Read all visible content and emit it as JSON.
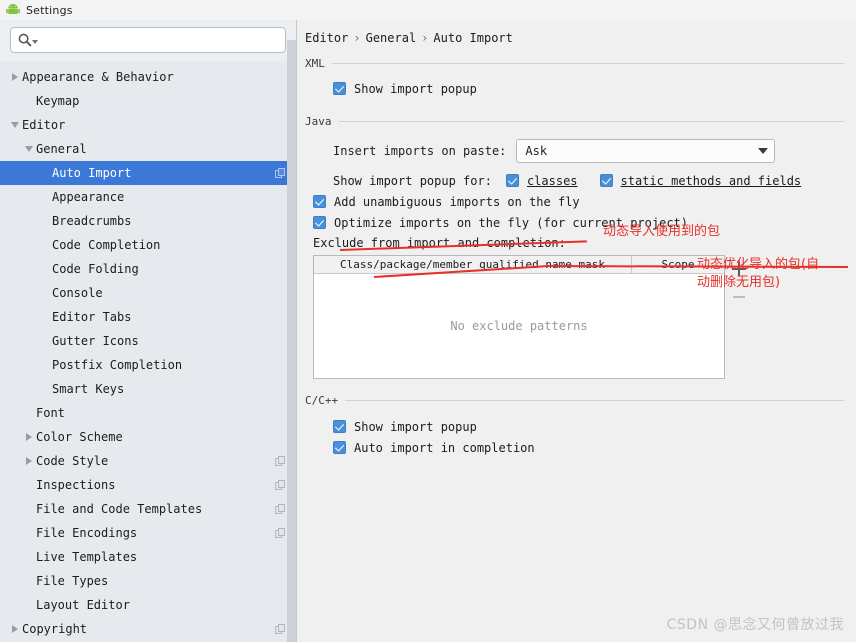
{
  "window": {
    "title": "Settings",
    "app_icon": "android-icon"
  },
  "search": {
    "value": "",
    "placeholder": "",
    "icon": "search-icon",
    "dropdown_icon": "chevron-down-icon"
  },
  "sidebar": {
    "items": [
      {
        "label": "Appearance & Behavior",
        "level": 0,
        "twisty": "closed",
        "selected": false,
        "copy": false
      },
      {
        "label": "Keymap",
        "level": 1,
        "twisty": "none",
        "selected": false,
        "copy": false
      },
      {
        "label": "Editor",
        "level": 0,
        "twisty": "open",
        "selected": false,
        "copy": false
      },
      {
        "label": "General",
        "level": 1,
        "twisty": "open",
        "selected": false,
        "copy": false
      },
      {
        "label": "Auto Import",
        "level": 2,
        "twisty": "none",
        "selected": true,
        "copy": true
      },
      {
        "label": "Appearance",
        "level": 2,
        "twisty": "none",
        "selected": false,
        "copy": false
      },
      {
        "label": "Breadcrumbs",
        "level": 2,
        "twisty": "none",
        "selected": false,
        "copy": false
      },
      {
        "label": "Code Completion",
        "level": 2,
        "twisty": "none",
        "selected": false,
        "copy": false
      },
      {
        "label": "Code Folding",
        "level": 2,
        "twisty": "none",
        "selected": false,
        "copy": false
      },
      {
        "label": "Console",
        "level": 2,
        "twisty": "none",
        "selected": false,
        "copy": false
      },
      {
        "label": "Editor Tabs",
        "level": 2,
        "twisty": "none",
        "selected": false,
        "copy": false
      },
      {
        "label": "Gutter Icons",
        "level": 2,
        "twisty": "none",
        "selected": false,
        "copy": false
      },
      {
        "label": "Postfix Completion",
        "level": 2,
        "twisty": "none",
        "selected": false,
        "copy": false
      },
      {
        "label": "Smart Keys",
        "level": 2,
        "twisty": "none",
        "selected": false,
        "copy": false
      },
      {
        "label": "Font",
        "level": 1,
        "twisty": "none",
        "selected": false,
        "copy": false
      },
      {
        "label": "Color Scheme",
        "level": 1,
        "twisty": "closed",
        "selected": false,
        "copy": false
      },
      {
        "label": "Code Style",
        "level": 1,
        "twisty": "closed",
        "selected": false,
        "copy": true
      },
      {
        "label": "Inspections",
        "level": 1,
        "twisty": "none",
        "selected": false,
        "copy": true
      },
      {
        "label": "File and Code Templates",
        "level": 1,
        "twisty": "none",
        "selected": false,
        "copy": true
      },
      {
        "label": "File Encodings",
        "level": 1,
        "twisty": "none",
        "selected": false,
        "copy": true
      },
      {
        "label": "Live Templates",
        "level": 1,
        "twisty": "none",
        "selected": false,
        "copy": false
      },
      {
        "label": "File Types",
        "level": 1,
        "twisty": "none",
        "selected": false,
        "copy": false
      },
      {
        "label": "Layout Editor",
        "level": 1,
        "twisty": "none",
        "selected": false,
        "copy": false
      },
      {
        "label": "Copyright",
        "level": 0,
        "twisty": "closed",
        "selected": false,
        "copy": true
      }
    ]
  },
  "breadcrumb": {
    "part1": "Editor",
    "part2": "General",
    "part3": "Auto Import",
    "sep": "›"
  },
  "xml": {
    "group_title": "XML",
    "show_import_popup": "Show import popup"
  },
  "java": {
    "group_title": "Java",
    "insert_label": "Insert imports on paste:",
    "insert_value": "Ask",
    "popup_for_label": "Show import popup for:",
    "classes_label": "classes",
    "static_label": "static methods and fields",
    "add_unambiguous": "Add unambiguous imports on the fly",
    "optimize_imports": "Optimize imports on the fly (for current project)",
    "exclude_label": "Exclude from import and completion:",
    "table": {
      "col1": "Class/package/member qualified name mask",
      "col2": "Scope",
      "empty_text": "No exclude patterns",
      "rows": []
    },
    "add_button": "+",
    "remove_button": "−"
  },
  "cpp": {
    "group_title": "C/C++",
    "show_import_popup": "Show import popup",
    "auto_import_completion": "Auto import in completion"
  },
  "annotations": [
    {
      "text": "动态导入使用到的包"
    },
    {
      "text": "动态优化导入的包(自"
    },
    {
      "text": "动删除无用包)"
    }
  ],
  "watermark": "CSDN @思念又何曾放过我",
  "colors": {
    "selection": "#3b78d8",
    "checkbox": "#4a90d9",
    "annotation": "#e8302a",
    "sidebar_bg": "#e6eaee",
    "panel_bg": "#f0f0f0"
  }
}
